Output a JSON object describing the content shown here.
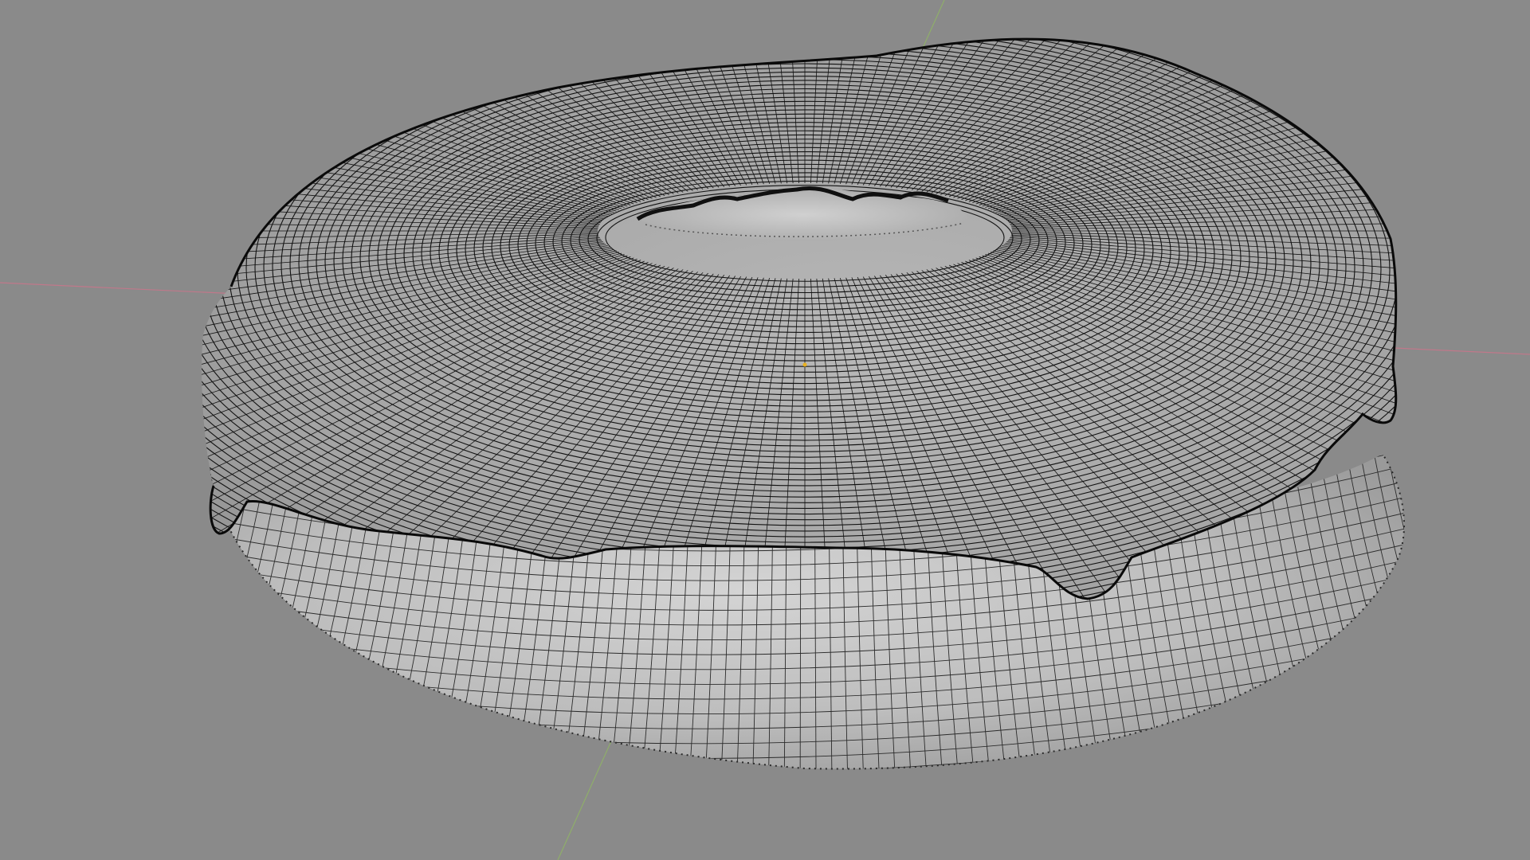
{
  "viewport": {
    "background_color": "#8a8a8a",
    "x_axis_color": "#c0788a",
    "y_axis_color": "#8fae6a",
    "z_axis_color": "#b9c29a",
    "origin_color": "#e8b020"
  },
  "object": {
    "kind": "donut-mesh",
    "display": "wireframe-overlay",
    "base_color": "#b9b9b9",
    "dough_wire_color": "#2b2b2b",
    "icing_wire_color": "#121212",
    "icing_vertex_color": "#080808"
  }
}
